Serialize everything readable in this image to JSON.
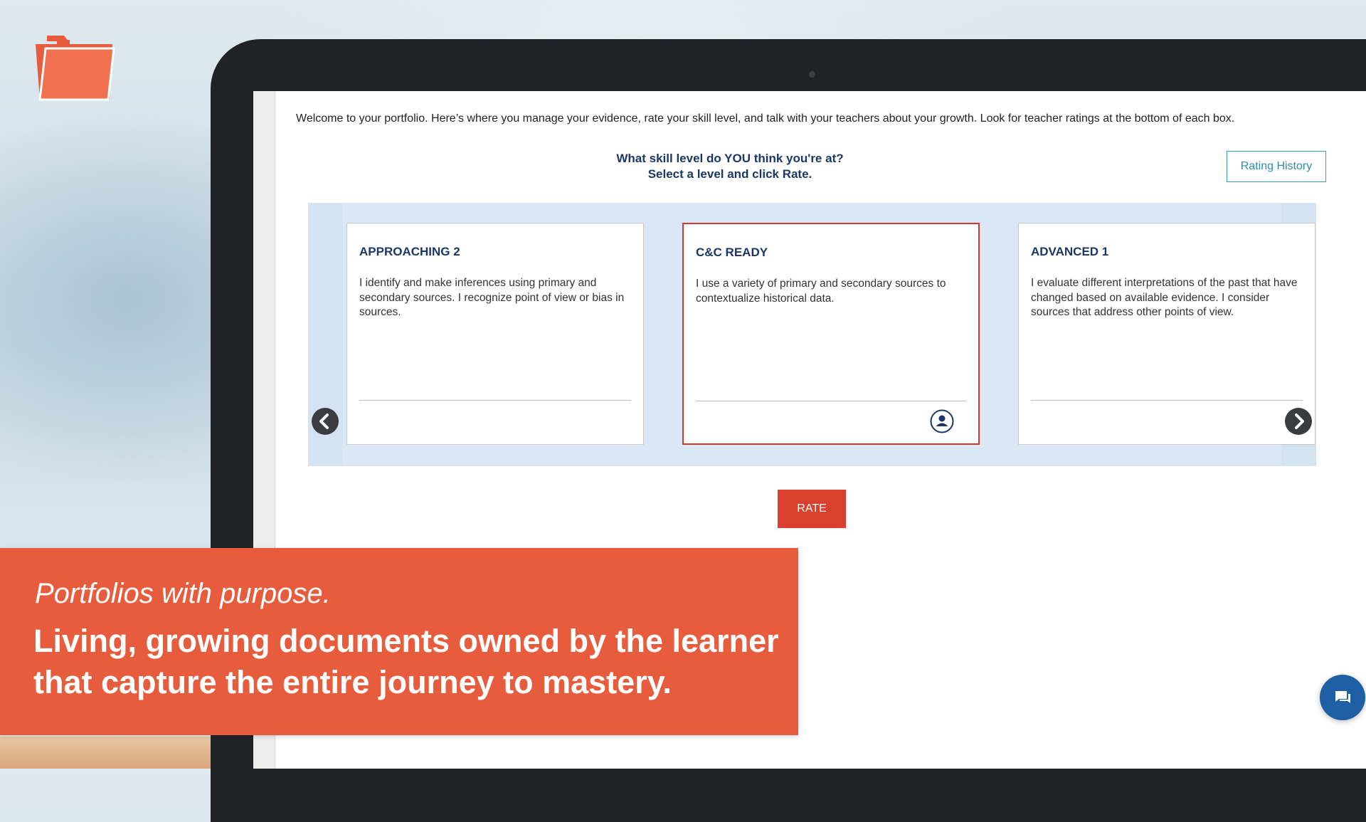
{
  "page": {
    "welcome": "Welcome to your portfolio. Here’s where you manage your evidence, rate your skill level, and talk with your teachers about your growth. Look for teacher ratings at the bottom of each box.",
    "question_line1": "What skill level do YOU think you're at?",
    "question_line2": "Select a level and click Rate.",
    "rating_history": "Rating History",
    "rate_label": "RATE"
  },
  "cards": [
    {
      "title": "APPROACHING 2",
      "description": "I identify and make inferences using primary and secondary sources. I recognize point of view or bias in sources.",
      "selected": false
    },
    {
      "title": "C&C READY",
      "description": "I use a variety of primary and secondary sources to contextualize historical data.",
      "selected": true
    },
    {
      "title": "ADVANCED 1",
      "description": "I evaluate different interpretations of the past that have changed based on available evidence. I consider sources that address other points of view.",
      "selected": false
    }
  ],
  "banner": {
    "tagline": "Portfolios with purpose.",
    "headline_line1": "Living, growing documents owned by the learner",
    "headline_line2": "that capture the entire journey to mastery."
  },
  "icons": {
    "logo": "folder-icon",
    "prev": "chevron-left-icon",
    "next": "chevron-right-icon",
    "user": "user-icon",
    "chat": "chat-icon"
  },
  "colors": {
    "brand_orange": "#e75c3c",
    "rate_button": "#d9402d",
    "selected_border": "#d43a2c",
    "navy_text": "#1c3766",
    "teal_accent": "#2f8ea9",
    "chat_blue": "#1f5fa5"
  }
}
